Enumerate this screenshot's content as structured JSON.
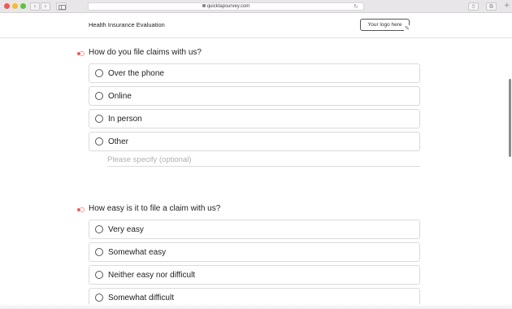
{
  "browser": {
    "url": "quicktapsurvey.com",
    "back_glyph": "‹",
    "forward_glyph": "›",
    "reload_glyph": "↻",
    "share_glyph": "⇧",
    "tabs_glyph": "⧉",
    "new_tab_glyph": "+"
  },
  "header": {
    "title": "Health Insurance Evaluation",
    "logo_placeholder": "Your logo here",
    "logo_edit_glyph": "✎"
  },
  "questions": [
    {
      "title": "How do you file claims with us?",
      "options": [
        "Over the phone",
        "Online",
        "In person",
        "Other"
      ],
      "specify_placeholder": "Please specify (optional)"
    },
    {
      "title": "How easy is it to file a claim with us?",
      "options": [
        "Very easy",
        "Somewhat easy",
        "Neither easy nor difficult",
        "Somewhat difficult"
      ]
    }
  ],
  "colors": {
    "required_marker": "#f05a5a"
  }
}
